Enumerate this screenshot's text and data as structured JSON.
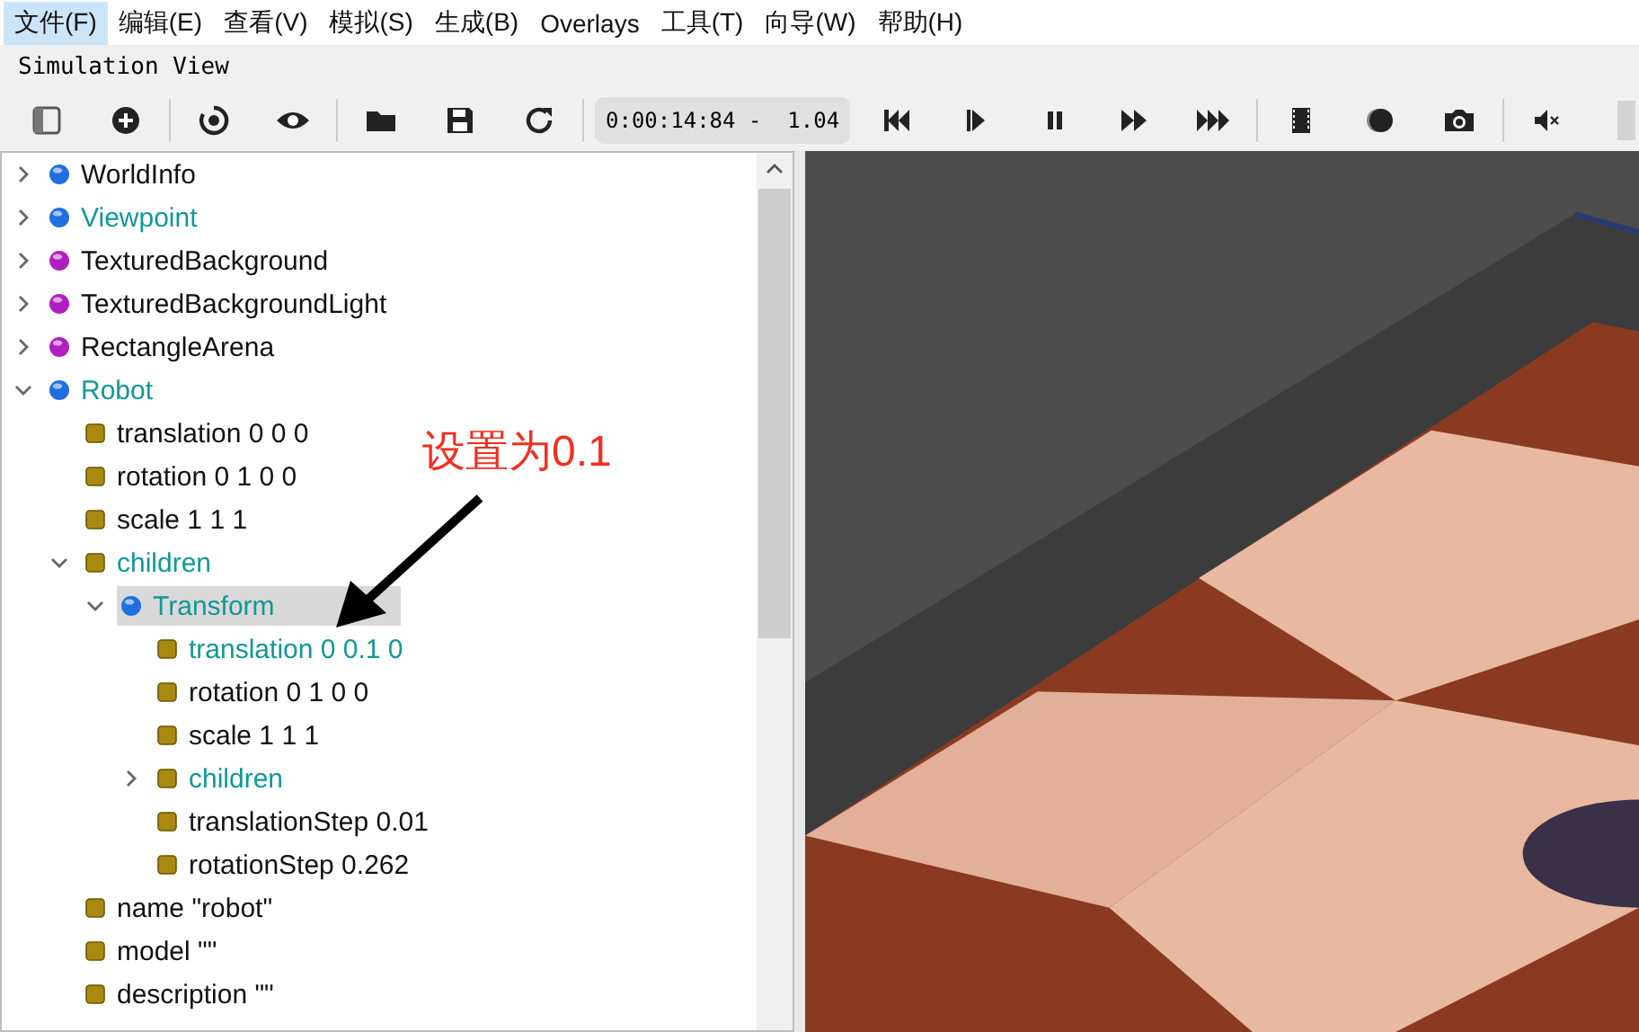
{
  "menu": [
    {
      "label": "文件(F)",
      "selected": true
    },
    {
      "label": "编辑(E)",
      "selected": false
    },
    {
      "label": "查看(V)",
      "selected": false
    },
    {
      "label": "模拟(S)",
      "selected": false
    },
    {
      "label": "生成(B)",
      "selected": false
    },
    {
      "label": "Overlays",
      "selected": false
    },
    {
      "label": "工具(T)",
      "selected": false
    },
    {
      "label": "向导(W)",
      "selected": false
    },
    {
      "label": "帮助(H)",
      "selected": false
    }
  ],
  "panel_title": "Simulation View",
  "toolbar": [
    {
      "kind": "panel"
    },
    {
      "kind": "add"
    },
    {
      "kind": "sep"
    },
    {
      "kind": "reset"
    },
    {
      "kind": "eye"
    },
    {
      "kind": "sep"
    },
    {
      "kind": "folder"
    },
    {
      "kind": "save"
    },
    {
      "kind": "reload"
    },
    {
      "kind": "sep"
    },
    {
      "kind": "time",
      "text": "0:00:14:84 -  1.04"
    },
    {
      "kind": "skip-back"
    },
    {
      "kind": "step"
    },
    {
      "kind": "pause"
    },
    {
      "kind": "fast"
    },
    {
      "kind": "faster"
    },
    {
      "kind": "sep"
    },
    {
      "kind": "film"
    },
    {
      "kind": "record"
    },
    {
      "kind": "camera"
    },
    {
      "kind": "sep"
    },
    {
      "kind": "mute"
    }
  ],
  "volume_slider": {
    "level": 0
  },
  "scene_tree": [
    {
      "label": "WorldInfo",
      "kind": "node",
      "modified": false,
      "expanded": false,
      "selected": false
    },
    {
      "label": "Viewpoint",
      "kind": "node",
      "modified": true,
      "expanded": false,
      "selected": false
    },
    {
      "label": "TexturedBackground",
      "kind": "proto",
      "modified": false,
      "expanded": false,
      "selected": false
    },
    {
      "label": "TexturedBackgroundLight",
      "kind": "proto",
      "modified": false,
      "expanded": false,
      "selected": false
    },
    {
      "label": "RectangleArena",
      "kind": "proto",
      "modified": false,
      "expanded": false,
      "selected": false
    },
    {
      "label": "Robot",
      "kind": "node",
      "modified": true,
      "expanded": true,
      "selected": false,
      "children": [
        {
          "label": "translation 0 0 0",
          "kind": "field",
          "modified": false,
          "selected": false
        },
        {
          "label": "rotation 0 1 0 0",
          "kind": "field",
          "modified": false,
          "selected": false
        },
        {
          "label": "scale 1 1 1",
          "kind": "field",
          "modified": false,
          "selected": false
        },
        {
          "label": "children",
          "kind": "field",
          "modified": true,
          "expanded": true,
          "selected": false,
          "children": [
            {
              "label": "Transform",
              "kind": "node",
              "modified": true,
              "expanded": true,
              "selected": true,
              "children": [
                {
                  "label": "translation 0 0.1 0",
                  "kind": "field",
                  "modified": true,
                  "selected": false
                },
                {
                  "label": "rotation 0 1 0 0",
                  "kind": "field",
                  "modified": false,
                  "selected": false
                },
                {
                  "label": "scale 1 1 1",
                  "kind": "field",
                  "modified": false,
                  "selected": false
                },
                {
                  "label": "children",
                  "kind": "field",
                  "modified": true,
                  "expanded": false,
                  "selected": false
                },
                {
                  "label": "translationStep 0.01",
                  "kind": "field",
                  "modified": false,
                  "selected": false
                },
                {
                  "label": "rotationStep 0.262",
                  "kind": "field",
                  "modified": false,
                  "selected": false
                }
              ]
            }
          ]
        },
        {
          "label": "name \"robot\"",
          "kind": "field",
          "modified": false,
          "selected": false
        },
        {
          "label": "model \"\"",
          "kind": "field",
          "modified": false,
          "selected": false
        },
        {
          "label": "description \"\"",
          "kind": "field",
          "modified": false,
          "selected": false
        }
      ]
    }
  ],
  "annotation": {
    "text": "设置为0.1"
  }
}
